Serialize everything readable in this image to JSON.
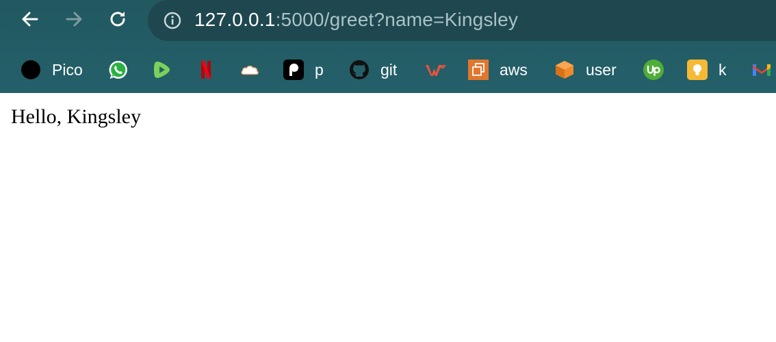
{
  "browser": {
    "url_host": "127.0.0.1",
    "url_path": ":5000/greet?name=Kingsley",
    "colors": {
      "toolbar_bg": "#225860",
      "omnibox_bg": "#1f474f",
      "url_host": "#ffffff",
      "url_path": "#a9c3c7"
    },
    "icons": {
      "back": "arrow-left-icon",
      "forward": "arrow-right-icon",
      "reload": "reload-icon",
      "site_info": "info-icon"
    }
  },
  "bookmarks": [
    {
      "label": "Pico",
      "icon": "black-circle-icon"
    },
    {
      "label": "",
      "icon": "whatsapp-icon"
    },
    {
      "label": "",
      "icon": "rumble-play-icon"
    },
    {
      "label": "",
      "icon": "netflix-icon"
    },
    {
      "label": "",
      "icon": "cloud-icon"
    },
    {
      "label": "p",
      "icon": "patreon-icon"
    },
    {
      "label": "git",
      "icon": "github-icon"
    },
    {
      "label": "",
      "icon": "w-logo-icon"
    },
    {
      "label": "aws",
      "icon": "aws-ec2-icon"
    },
    {
      "label": "user",
      "icon": "orange-cube-icon"
    },
    {
      "label": "",
      "icon": "upwork-icon"
    },
    {
      "label": "k",
      "icon": "bulb-icon"
    },
    {
      "label": "",
      "icon": "gmail-icon"
    }
  ],
  "page": {
    "greeting": "Hello, Kingsley"
  }
}
